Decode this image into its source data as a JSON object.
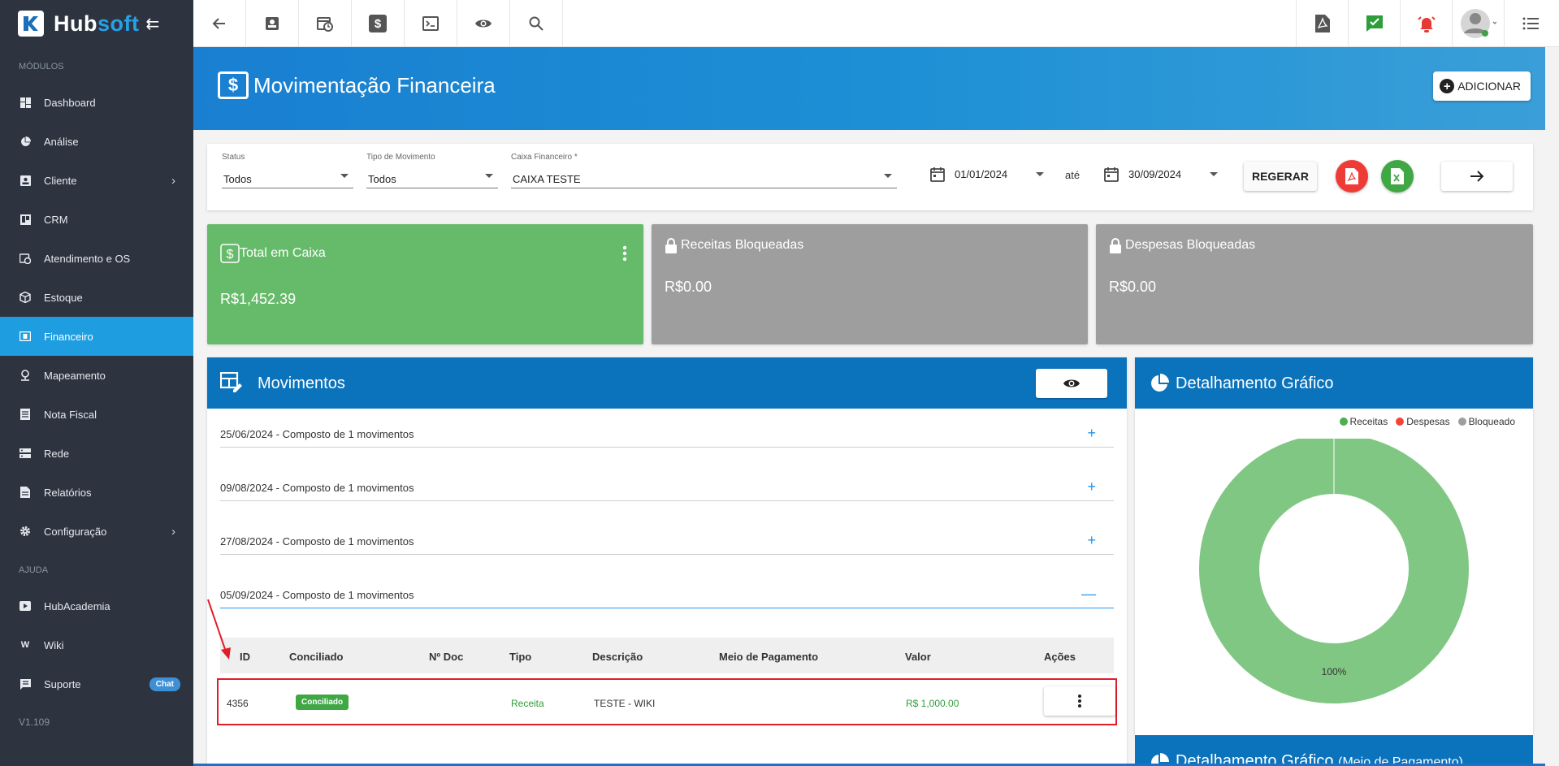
{
  "brand": {
    "name_a": "Hub",
    "name_b": "soft"
  },
  "sidebar": {
    "section_modules": "MÓDULOS",
    "section_help": "AJUDA",
    "items": [
      {
        "label": "Dashboard",
        "icon": "dashboard-icon"
      },
      {
        "label": "Análise",
        "icon": "pie-icon"
      },
      {
        "label": "Cliente",
        "icon": "contact-icon"
      },
      {
        "label": "CRM",
        "icon": "board-icon"
      },
      {
        "label": "Atendimento e OS",
        "icon": "calendar-clock-icon"
      },
      {
        "label": "Estoque",
        "icon": "box-icon"
      },
      {
        "label": "Financeiro",
        "icon": "money-icon"
      },
      {
        "label": "Mapeamento",
        "icon": "map-pin-icon"
      },
      {
        "label": "Nota Fiscal",
        "icon": "document-icon"
      },
      {
        "label": "Rede",
        "icon": "server-icon"
      },
      {
        "label": "Relatórios",
        "icon": "report-icon"
      },
      {
        "label": "Configuração",
        "icon": "gear-icon"
      }
    ],
    "help_items": [
      {
        "label": "HubAcademia",
        "icon": "play-icon"
      },
      {
        "label": "Wiki",
        "icon": "wiki-icon"
      },
      {
        "label": "Suporte",
        "icon": "chat-icon",
        "badge": "Chat"
      }
    ],
    "version": "V1.109"
  },
  "page": {
    "title": "Movimentação Financeira",
    "add_label": "ADICIONAR"
  },
  "filters": {
    "status_label": "Status",
    "status_value": "Todos",
    "tipo_label": "Tipo de Movimento",
    "tipo_value": "Todos",
    "caixa_label": "Caixa Financeiro *",
    "caixa_value": "CAIXA TESTE",
    "date_from": "01/01/2024",
    "ate": "até",
    "date_to": "30/09/2024",
    "regerar_label": "REGERAR"
  },
  "cards": {
    "total_title": "Total em Caixa",
    "total_value": "R$1,452.39",
    "receitas_title": "Receitas Bloqueadas",
    "receitas_value": "R$0.00",
    "despesas_title": "Despesas Bloqueadas",
    "despesas_value": "R$0.00"
  },
  "movimentos": {
    "title": "Movimentos",
    "groups": [
      {
        "text": "25/06/2024 - Composto de 1 movimentos",
        "sign": "+"
      },
      {
        "text": "09/08/2024 - Composto de 1 movimentos",
        "sign": "+"
      },
      {
        "text": "27/08/2024 - Composto de 1 movimentos",
        "sign": "+"
      },
      {
        "text": "05/09/2024 - Composto de 1 movimentos",
        "sign": "—"
      }
    ],
    "columns": [
      "ID",
      "Conciliado",
      "Nº Doc",
      "Tipo",
      "Descrição",
      "Meio de Pagamento",
      "Valor",
      "Ações"
    ],
    "row": {
      "id": "4356",
      "conciliado": "Conciliado",
      "ndoc": "",
      "tipo": "Receita",
      "descricao": "TESTE - WIKI",
      "meio": "",
      "valor": "R$ 1,000.00"
    }
  },
  "chart_panel": {
    "title": "Detalhamento Gráfico",
    "title2": "Detalhamento Gráfico",
    "title2_sub": "(Meio de Pagamento)"
  },
  "chart_data": {
    "type": "pie",
    "donut": true,
    "categories": [
      "Receitas",
      "Despesas",
      "Bloqueado"
    ],
    "values": [
      100,
      0,
      0
    ],
    "colors": [
      "#81c784",
      "#f44336",
      "#9e9e9e"
    ],
    "data_labels": [
      "100%"
    ],
    "legend": "top-right"
  },
  "colors": {
    "sidebar_bg": "#2d3440",
    "active": "#1e9ee0",
    "header_blue": "#0b73bc",
    "green_card": "#66bb6a",
    "gray_card": "#9e9e9e",
    "receita_green": "#2e9e3a",
    "highlight_red": "#e11d2a"
  }
}
